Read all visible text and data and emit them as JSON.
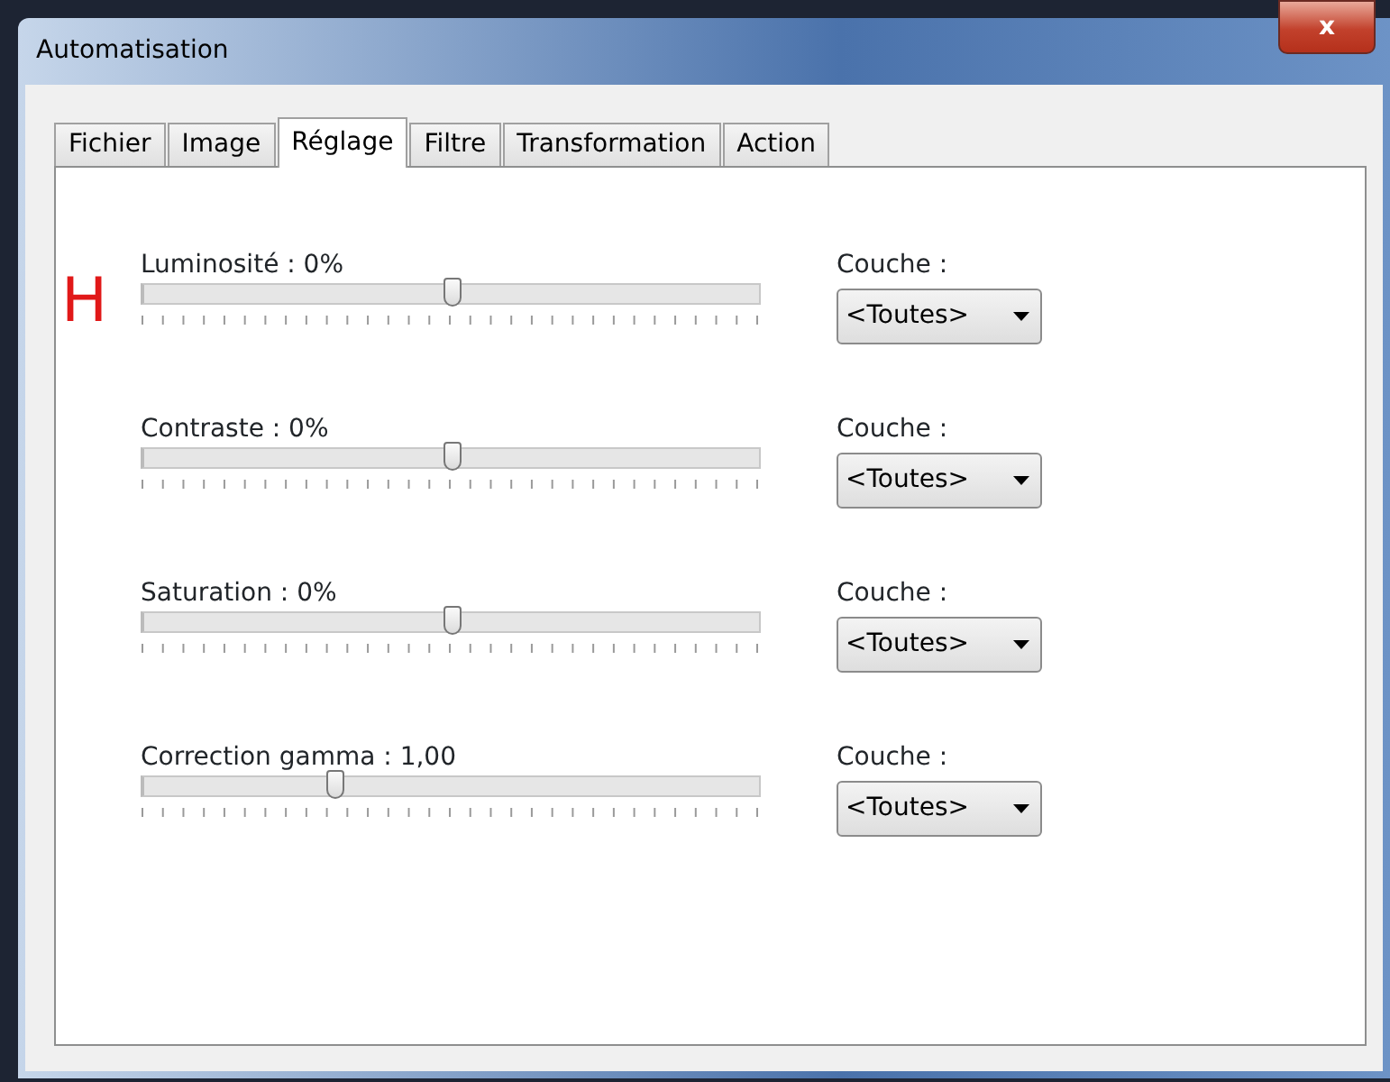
{
  "window": {
    "title": "Automatisation",
    "close": "x"
  },
  "tabs": [
    {
      "label": "Fichier",
      "selected": false
    },
    {
      "label": "Image",
      "selected": false
    },
    {
      "label": "Réglage",
      "selected": true
    },
    {
      "label": "Filtre",
      "selected": false
    },
    {
      "label": "Transformation",
      "selected": false
    },
    {
      "label": "Action",
      "selected": false
    }
  ],
  "annotation": "H",
  "adjustments": [
    {
      "label": "Luminosité : 0%",
      "level": 0.5,
      "layer_label": "Couche :",
      "layer": "<Toutes>"
    },
    {
      "label": "Contraste : 0%",
      "level": 0.5,
      "layer_label": "Couche :",
      "layer": "<Toutes>"
    },
    {
      "label": "Saturation : 0%",
      "level": 0.5,
      "layer_label": "Couche :",
      "layer": "<Toutes>"
    },
    {
      "label": "Correction gamma : 1,00",
      "level": 0.31,
      "layer_label": "Couche :",
      "layer": "<Toutes>"
    }
  ]
}
